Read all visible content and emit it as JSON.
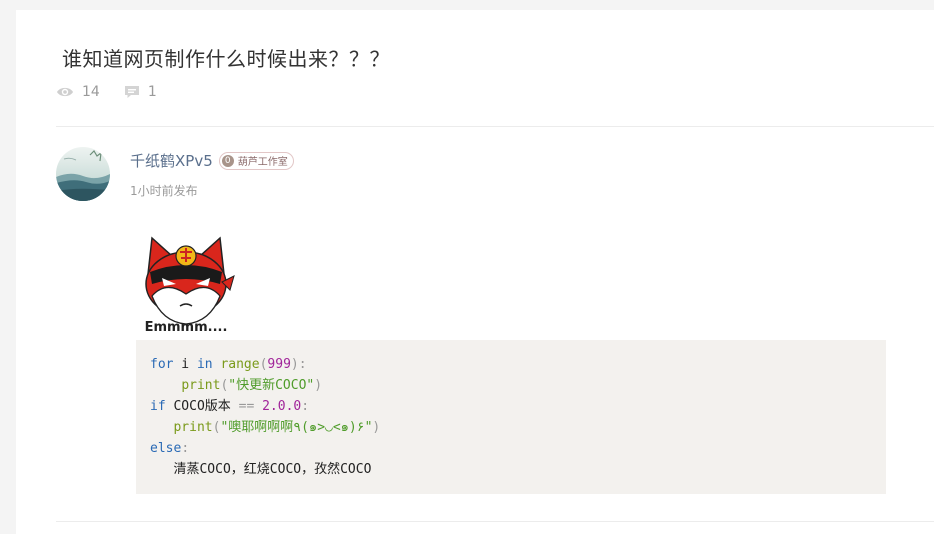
{
  "post": {
    "title": "谁知道网页制作什么时候出来？？？",
    "views": "14",
    "comments": "1"
  },
  "reply": {
    "author": "千纸鹤XPv5",
    "badge_level": "0",
    "badge_label": "葫芦工作室",
    "time": "1小时前发布",
    "sticker_text": "Emmmm...."
  },
  "code": {
    "l1_for": "for",
    "l1_i": " i ",
    "l1_in": "in",
    "l1_range": " range",
    "l1_open": "(",
    "l1_num": "999",
    "l1_close": "):",
    "l2_indent": "    ",
    "l2_print": "print",
    "l2_open": "(",
    "l2_str": "\"快更新COCO\"",
    "l2_close": ")",
    "l3_if": "if",
    "l3_text": " COCO版本 ",
    "l3_op": "==",
    "l3_sp": " ",
    "l3_num": "2.0.0",
    "l3_colon": ":",
    "l4_indent": "   ",
    "l4_print": "print",
    "l4_open": "(",
    "l4_str": "\"噢耶啊啊啊٩(๑>◡<๑)۶\"",
    "l4_close": ")",
    "l5_else": "else",
    "l5_colon": ":",
    "l6_indent": "   ",
    "l6_text": "清蒸COCO，红烧COCO，孜然COCO"
  },
  "colors": {
    "keyword": "#2a6ab5",
    "function": "#7a9a1a",
    "number": "#a1259a",
    "string": "#4f9c2a",
    "author": "#5a6f8c"
  },
  "icons": [
    "eye-icon",
    "comment-icon"
  ]
}
